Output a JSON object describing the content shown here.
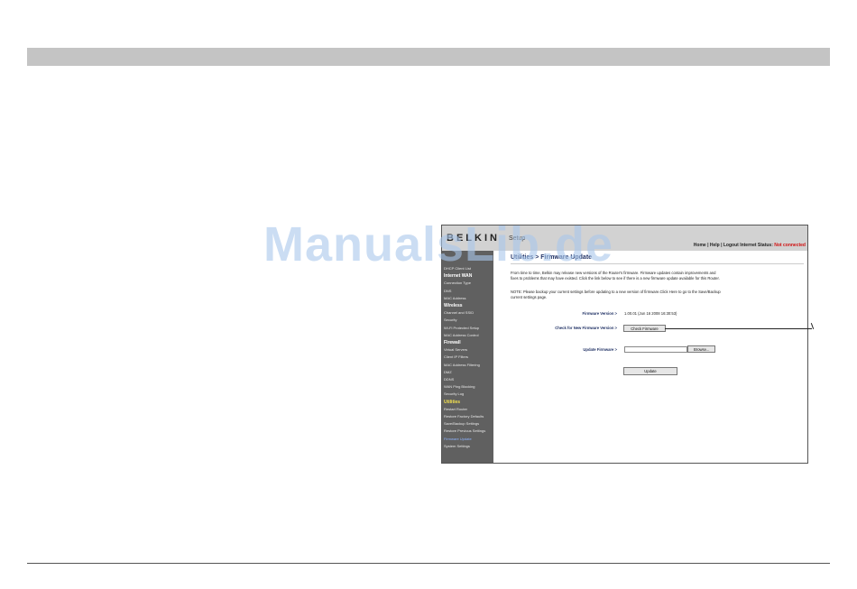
{
  "watermark": "ManualsLib.de",
  "router": {
    "brand": "BELKIN",
    "brand_sub": "Setup",
    "header_links": "Home | Help | Logout   Internet Status:",
    "internet_status": "Not connected",
    "colors": {
      "status_red": "#d01010",
      "sidebar": "#606060",
      "header": "#d2d2d2",
      "utilities": "#f2e050"
    }
  },
  "sidebar": {
    "items": [
      {
        "label": "DHCP Client List",
        "type": "item"
      },
      {
        "label": "Internet WAN",
        "type": "head"
      },
      {
        "label": "Connection Type",
        "type": "item"
      },
      {
        "label": "DNS",
        "type": "item"
      },
      {
        "label": "MAC Address",
        "type": "item"
      },
      {
        "label": "Wireless",
        "type": "head"
      },
      {
        "label": "Channel and SSID",
        "type": "item"
      },
      {
        "label": "Security",
        "type": "item"
      },
      {
        "label": "Wi-Fi Protected Setup",
        "type": "item"
      },
      {
        "label": "MAC Address Control",
        "type": "item"
      },
      {
        "label": "Firewall",
        "type": "head"
      },
      {
        "label": "Virtual Servers",
        "type": "item"
      },
      {
        "label": "Client IP Filters",
        "type": "item"
      },
      {
        "label": "MAC Address Filtering",
        "type": "item"
      },
      {
        "label": "DMZ",
        "type": "item"
      },
      {
        "label": "DDNS",
        "type": "item"
      },
      {
        "label": "WAN Ping Blocking",
        "type": "item"
      },
      {
        "label": "Security Log",
        "type": "item"
      },
      {
        "label": "Utilities",
        "type": "head"
      },
      {
        "label": "Restart Router",
        "type": "item"
      },
      {
        "label": "Restore Factory Defaults",
        "type": "item"
      },
      {
        "label": "Save/Backup Settings",
        "type": "item"
      },
      {
        "label": "Restore Previous Settings",
        "type": "item"
      },
      {
        "label": "Firmware Update",
        "type": "item"
      },
      {
        "label": "System Settings",
        "type": "item"
      }
    ]
  },
  "content": {
    "page_title": "Utilities > Firmware Update",
    "para1_line1": "From time to time, Belkin may release new versions of the Router's firmware. Firmware updates contain improvements and",
    "para1_line2": "fixes to problems that may have existed. Click the link below to see if there is a new firmware update available for this Router.",
    "note_line1": "NOTE: Please backup your current settings before updating to a new version of firmware.Click Here to go to the Save/Backup",
    "note_line2": "current settings page.",
    "firmware_version_label": "Firmware Version >",
    "firmware_version_value": "1.00.01 (Jun 16 2008 16:30:53)",
    "check_label": "Check for New Firmware Version >",
    "check_button": "Check Firmware",
    "update_label": "Update Firmware >",
    "browse_button": "Browse...",
    "update_button": "Update"
  }
}
